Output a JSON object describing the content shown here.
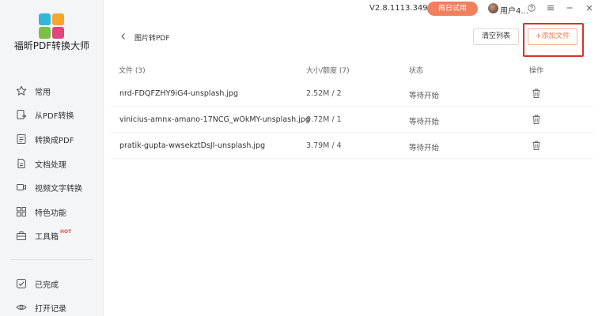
{
  "app": {
    "title": "福昕PDF转换大师",
    "version": "V2.8.1113.349",
    "trial_button": "再日试用",
    "user_name": "用户4...",
    "logo_colors": [
      "#31b7d8",
      "#f5a62b",
      "#7ac043",
      "#e0457d"
    ]
  },
  "sidebar": {
    "items": [
      {
        "label": "常用",
        "icon": "star-icon"
      },
      {
        "label": "从PDF转换",
        "icon": "pdf-convert-icon"
      },
      {
        "label": "转换成PDF",
        "icon": "to-pdf-icon"
      },
      {
        "label": "文档处理",
        "icon": "document-icon"
      },
      {
        "label": "视频文字转换",
        "icon": "video-icon"
      },
      {
        "label": "特色功能",
        "icon": "grid-icon"
      },
      {
        "label": "工具箱",
        "icon": "toolbox-icon",
        "badge": "HOT"
      }
    ],
    "bottom_items": [
      {
        "label": "已完成",
        "icon": "check-icon"
      },
      {
        "label": "打开记录",
        "icon": "eye-icon"
      }
    ]
  },
  "page": {
    "title": "图片转PDF",
    "clear_button": "清空列表",
    "add_button": "+添加文件"
  },
  "table": {
    "headers": {
      "file": "文件 (3)",
      "size": "大小/额度 (7)",
      "status": "状态",
      "actions": "操作"
    },
    "rows": [
      {
        "name": "nrd-FDQFZHY9iG4-unsplash.jpg",
        "size": "2.52M / 2",
        "status": "等待开始"
      },
      {
        "name": "vinicius-amnx-amano-17NCG_wOkMY-unsplash.jpg",
        "size": "0.72M / 1",
        "status": "等待开始"
      },
      {
        "name": "pratik-gupta-wwsekztDsJI-unsplash.jpg",
        "size": "3.79M / 4",
        "status": "等待开始"
      }
    ]
  },
  "colors": {
    "accent": "#f07f5c",
    "highlight": "#d8332c",
    "sidebar_bg": "#f4f5f7"
  }
}
